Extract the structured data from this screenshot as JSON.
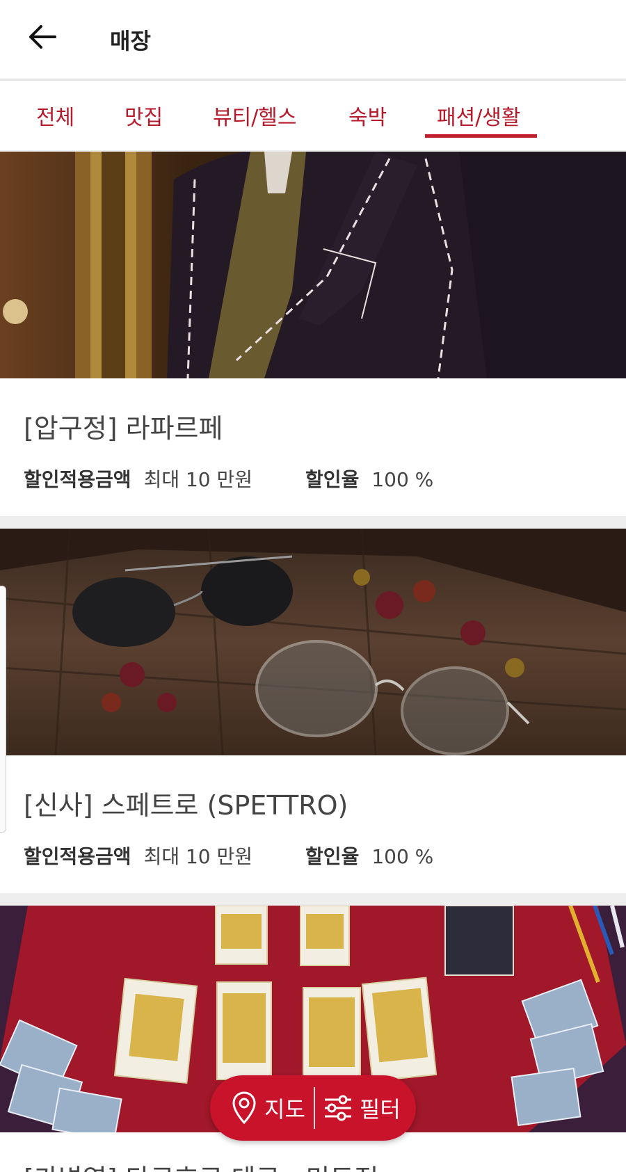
{
  "header": {
    "title": "매장",
    "back_icon": "arrow-left-icon"
  },
  "tabs": [
    {
      "label": "전체"
    },
    {
      "label": "맛집"
    },
    {
      "label": "뷰티/헬스"
    },
    {
      "label": "숙박"
    },
    {
      "label": "패션/생활",
      "active": true
    }
  ],
  "stores": [
    {
      "title": "[압구정] 라파르페",
      "amount_label": "할인적용금액",
      "amount_value": "최대 10 만원",
      "rate_label": "할인율",
      "rate_value": "100 %"
    },
    {
      "title": "[신사] 스페트로 (SPETTRO)",
      "amount_label": "할인적용금액",
      "amount_value": "최대 10 만원",
      "rate_label": "할인율",
      "rate_value": "100 %"
    },
    {
      "title": "[가변영] 타로호로 테로 : 미도전"
    }
  ],
  "float_bar": {
    "map_label": "지도",
    "filter_label": "필터",
    "map_icon": "map-pin-icon",
    "filter_icon": "sliders-icon"
  },
  "colors": {
    "accent": "#c8132b",
    "tab_text": "#b51a2b"
  }
}
